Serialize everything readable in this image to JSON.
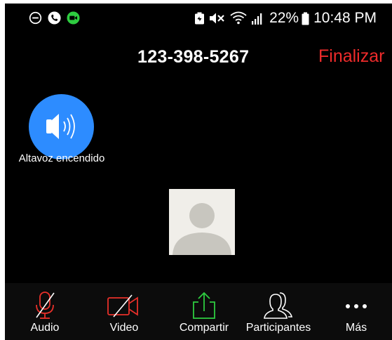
{
  "status_bar": {
    "battery_percent": "22%",
    "time": "10:48 PM",
    "left_icons": [
      "do-not-disturb-icon",
      "phone-call-icon",
      "zoom-video-icon"
    ],
    "right_icons": [
      "battery-saver-icon",
      "mute-icon",
      "wifi-icon",
      "signal-icon",
      "battery-icon"
    ]
  },
  "header": {
    "meeting_id": "123-398-5267",
    "end_label": "Finalizar"
  },
  "speaker": {
    "label": "Altavoz encendido",
    "icon": "speaker-on-icon"
  },
  "toolbar": {
    "items": [
      {
        "label": "Audio",
        "icon": "microphone-muted-icon"
      },
      {
        "label": "Video",
        "icon": "video-off-icon"
      },
      {
        "label": "Compartir",
        "icon": "share-icon"
      },
      {
        "label": "Participantes",
        "icon": "participants-icon"
      },
      {
        "label": "Más",
        "icon": "more-icon"
      }
    ]
  },
  "colors": {
    "background": "#000000",
    "accent_blue": "#2d8cff",
    "end_red": "#ee2b2b",
    "muted_red": "#e8302a",
    "share_green": "#2ecc40"
  }
}
